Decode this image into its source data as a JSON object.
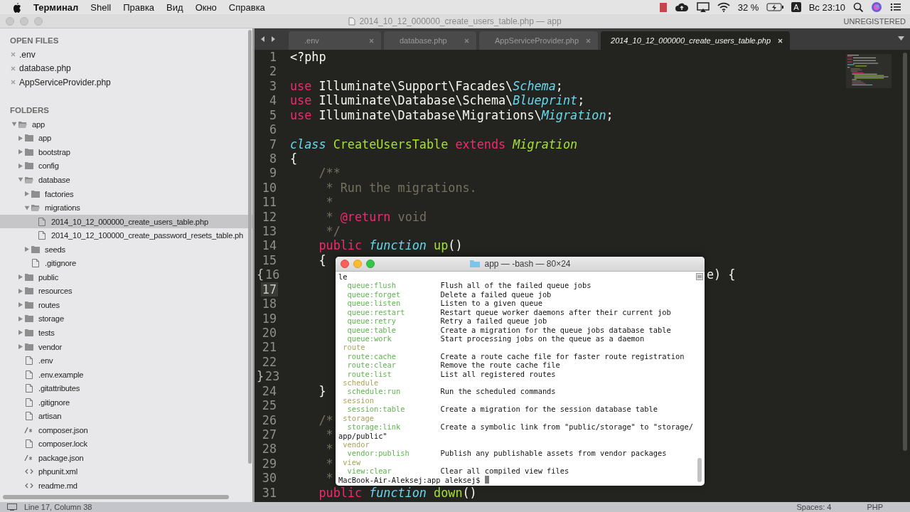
{
  "menu_bar": {
    "app_name": "Терминал",
    "menus": [
      "Shell",
      "Правка",
      "Вид",
      "Окно",
      "Справка"
    ],
    "battery": "32 %",
    "input_source": "A",
    "clock": "Вс 23:10"
  },
  "window": {
    "title": "2014_10_12_000000_create_users_table.php — app",
    "license": "UNREGISTERED"
  },
  "sidebar": {
    "open_files_title": "OPEN FILES",
    "open_files": [
      {
        "name": ".env"
      },
      {
        "name": "database.php"
      },
      {
        "name": "AppServiceProvider.php"
      }
    ],
    "folders_title": "FOLDERS",
    "tree": [
      {
        "name": "app",
        "kind": "folder",
        "expanded": true,
        "selected": false,
        "children": [
          {
            "name": "app",
            "kind": "folder",
            "expanded": false,
            "selected": false
          },
          {
            "name": "bootstrap",
            "kind": "folder",
            "expanded": false,
            "selected": false
          },
          {
            "name": "config",
            "kind": "folder",
            "expanded": false,
            "selected": false
          },
          {
            "name": "database",
            "kind": "folder",
            "expanded": true,
            "selected": false,
            "children": [
              {
                "name": "factories",
                "kind": "folder",
                "expanded": false,
                "selected": false
              },
              {
                "name": "migrations",
                "kind": "folder",
                "expanded": true,
                "selected": false,
                "children": [
                  {
                    "name": "2014_10_12_000000_create_users_table.php",
                    "kind": "file",
                    "selected": true
                  },
                  {
                    "name": "2014_10_12_100000_create_password_resets_table.ph",
                    "kind": "file",
                    "selected": false
                  }
                ]
              },
              {
                "name": "seeds",
                "kind": "folder",
                "expanded": false,
                "selected": false
              },
              {
                "name": ".gitignore",
                "kind": "file",
                "selected": false
              }
            ]
          },
          {
            "name": "public",
            "kind": "folder",
            "expanded": false,
            "selected": false
          },
          {
            "name": "resources",
            "kind": "folder",
            "expanded": false,
            "selected": false
          },
          {
            "name": "routes",
            "kind": "folder",
            "expanded": false,
            "selected": false
          },
          {
            "name": "storage",
            "kind": "folder",
            "expanded": false,
            "selected": false
          },
          {
            "name": "tests",
            "kind": "folder",
            "expanded": false,
            "selected": false
          },
          {
            "name": "vendor",
            "kind": "folder",
            "expanded": false,
            "selected": false
          },
          {
            "name": ".env",
            "kind": "file",
            "selected": false
          },
          {
            "name": ".env.example",
            "kind": "file",
            "selected": false
          },
          {
            "name": ".gitattributes",
            "kind": "file",
            "selected": false
          },
          {
            "name": ".gitignore",
            "kind": "file",
            "selected": false
          },
          {
            "name": "artisan",
            "kind": "file",
            "selected": false
          },
          {
            "name": "composer.json",
            "kind": "json",
            "selected": false
          },
          {
            "name": "composer.lock",
            "kind": "file",
            "selected": false
          },
          {
            "name": "package.json",
            "kind": "json",
            "selected": false
          },
          {
            "name": "phpunit.xml",
            "kind": "markup",
            "selected": false
          },
          {
            "name": "readme.md",
            "kind": "markup",
            "selected": false
          }
        ]
      }
    ]
  },
  "tabs": [
    {
      "label": ".env",
      "selected": false
    },
    {
      "label": "database.php",
      "selected": false
    },
    {
      "label": "AppServiceProvider.php",
      "selected": false
    },
    {
      "label": "2014_10_12_000000_create_users_table.php",
      "selected": true
    }
  ],
  "editor": {
    "lines": [
      {
        "number": "1",
        "current": false,
        "tokens": [
          {
            "text": "<?php",
            "kind": "plain"
          }
        ]
      },
      {
        "number": "2",
        "current": false
      },
      {
        "number": "3",
        "current": false,
        "tokens": [
          {
            "text": "use",
            "kind": "keyword"
          },
          {
            "text": " Illuminate\\Support\\Facades\\",
            "kind": "plain"
          },
          {
            "text": "Schema",
            "kind": "storage"
          },
          {
            "text": ";",
            "kind": "plain"
          }
        ]
      },
      {
        "number": "4",
        "current": false,
        "tokens": [
          {
            "text": "use",
            "kind": "keyword"
          },
          {
            "text": " Illuminate\\Database\\Schema\\",
            "kind": "plain"
          },
          {
            "text": "Blueprint",
            "kind": "storage"
          },
          {
            "text": ";",
            "kind": "plain"
          }
        ]
      },
      {
        "number": "5",
        "current": false,
        "tokens": [
          {
            "text": "use",
            "kind": "keyword"
          },
          {
            "text": " Illuminate\\Database\\Migrations\\",
            "kind": "plain"
          },
          {
            "text": "Migration",
            "kind": "storage"
          },
          {
            "text": ";",
            "kind": "plain"
          }
        ]
      },
      {
        "number": "6",
        "current": false
      },
      {
        "number": "7",
        "current": false,
        "tokens": [
          {
            "text": "class",
            "kind": "storage"
          },
          {
            "text": " CreateUsersTable",
            "kind": "entity"
          },
          {
            "text": " extends",
            "kind": "keyword"
          },
          {
            "text": " Migration",
            "kind": "inherited"
          }
        ]
      },
      {
        "number": "8",
        "current": false,
        "tokens": [
          {
            "text": "{",
            "kind": "plain"
          }
        ]
      },
      {
        "number": "9",
        "current": false,
        "tokens": [
          {
            "text": "    /**",
            "kind": "comment"
          }
        ]
      },
      {
        "number": "10",
        "current": false,
        "tokens": [
          {
            "text": "     * Run the migrations.",
            "kind": "comment"
          }
        ]
      },
      {
        "number": "11",
        "current": false,
        "tokens": [
          {
            "text": "     *",
            "kind": "comment"
          }
        ]
      },
      {
        "number": "12",
        "current": false,
        "tokens": [
          {
            "text": "     *",
            "kind": "comment"
          },
          {
            "text": " @return",
            "kind": "keyword"
          },
          {
            "text": " void",
            "kind": "comment"
          }
        ]
      },
      {
        "number": "13",
        "current": false,
        "tokens": [
          {
            "text": "     */",
            "kind": "comment"
          }
        ]
      },
      {
        "number": "14",
        "current": false,
        "tokens": [
          {
            "text": "    public",
            "kind": "keyword"
          },
          {
            "text": " function",
            "kind": "storage"
          },
          {
            "text": " up",
            "kind": "entity"
          },
          {
            "text": "()",
            "kind": "plain"
          }
        ]
      },
      {
        "number": "15",
        "current": false,
        "tokens": [
          {
            "text": "    {",
            "kind": "plain"
          }
        ]
      },
      {
        "number": "16",
        "current": false,
        "fold": "{",
        "tokens": [
          {
            "text": "                                                          e) {",
            "kind": "plain"
          }
        ]
      },
      {
        "number": "17",
        "current": true
      },
      {
        "number": "18",
        "current": false
      },
      {
        "number": "19",
        "current": false
      },
      {
        "number": "20",
        "current": false
      },
      {
        "number": "21",
        "current": false
      },
      {
        "number": "22",
        "current": false
      },
      {
        "number": "23",
        "current": false,
        "fold": "}"
      },
      {
        "number": "24",
        "current": false,
        "tokens": [
          {
            "text": "    }",
            "kind": "plain"
          }
        ]
      },
      {
        "number": "25",
        "current": false
      },
      {
        "number": "26",
        "current": false,
        "tokens": [
          {
            "text": "    /*",
            "kind": "comment"
          }
        ]
      },
      {
        "number": "27",
        "current": false,
        "tokens": [
          {
            "text": "     *",
            "kind": "comment"
          }
        ]
      },
      {
        "number": "28",
        "current": false,
        "tokens": [
          {
            "text": "     *",
            "kind": "comment"
          }
        ]
      },
      {
        "number": "29",
        "current": false,
        "tokens": [
          {
            "text": "     *",
            "kind": "comment"
          }
        ]
      },
      {
        "number": "30",
        "current": false,
        "tokens": [
          {
            "text": "     *",
            "kind": "comment"
          }
        ]
      },
      {
        "number": "31",
        "current": false,
        "tokens": [
          {
            "text": "    public",
            "kind": "keyword"
          },
          {
            "text": " function",
            "kind": "storage"
          },
          {
            "text": " down",
            "kind": "entity"
          },
          {
            "text": "()",
            "kind": "plain"
          }
        ]
      }
    ]
  },
  "terminal": {
    "title": "app — -bash — 80×24",
    "lines": [
      {
        "kind": "plain",
        "text": "le"
      },
      {
        "kind": "command",
        "name": "queue:flush",
        "description": "Flush all of the failed queue jobs"
      },
      {
        "kind": "command",
        "name": "queue:forget",
        "description": "Delete a failed queue job"
      },
      {
        "kind": "command",
        "name": "queue:listen",
        "description": "Listen to a given queue"
      },
      {
        "kind": "command",
        "name": "queue:restart",
        "description": "Restart queue worker daemons after their current job"
      },
      {
        "kind": "command",
        "name": "queue:retry",
        "description": "Retry a failed queue job"
      },
      {
        "kind": "command",
        "name": "queue:table",
        "description": "Create a migration for the queue jobs database table"
      },
      {
        "kind": "command",
        "name": "queue:work",
        "description": "Start processing jobs on the queue as a daemon"
      },
      {
        "kind": "group",
        "text": "route"
      },
      {
        "kind": "command",
        "name": "route:cache",
        "description": "Create a route cache file for faster route registration"
      },
      {
        "kind": "command",
        "name": "route:clear",
        "description": "Remove the route cache file"
      },
      {
        "kind": "command",
        "name": "route:list",
        "description": "List all registered routes"
      },
      {
        "kind": "group",
        "text": "schedule"
      },
      {
        "kind": "command",
        "name": "schedule:run",
        "description": "Run the scheduled commands"
      },
      {
        "kind": "group",
        "text": "session"
      },
      {
        "kind": "command",
        "name": "session:table",
        "description": "Create a migration for the session database table"
      },
      {
        "kind": "group",
        "text": "storage"
      },
      {
        "kind": "command",
        "name": "storage:link",
        "description": "Create a symbolic link from \"public/storage\" to \"storage/"
      },
      {
        "kind": "plain",
        "text": "app/public\""
      },
      {
        "kind": "group",
        "text": "vendor"
      },
      {
        "kind": "command",
        "name": "vendor:publish",
        "description": "Publish any publishable assets from vendor packages"
      },
      {
        "kind": "group",
        "text": "view"
      },
      {
        "kind": "command",
        "name": "view:clear",
        "description": "Clear all compiled view files"
      },
      {
        "kind": "prompt",
        "text": "MacBook-Air-Aleksej:app aleksej$"
      }
    ]
  },
  "status_bar": {
    "position": "Line 17, Column 38",
    "indentation": "Spaces: 4",
    "syntax": "PHP"
  }
}
